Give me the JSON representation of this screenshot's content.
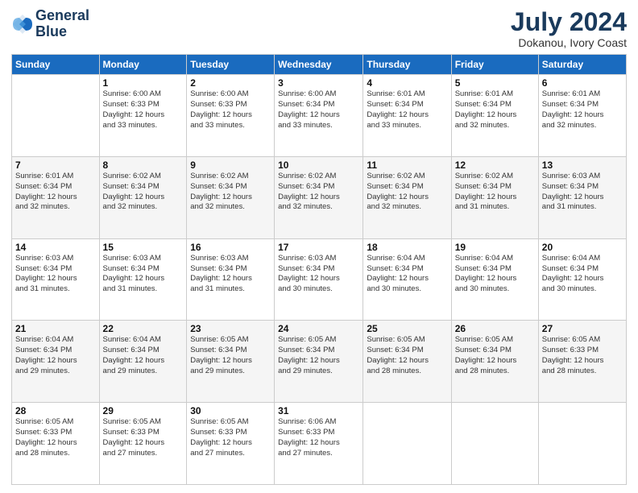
{
  "logo": {
    "line1": "General",
    "line2": "Blue"
  },
  "title": {
    "month_year": "July 2024",
    "location": "Dokanou, Ivory Coast"
  },
  "days_of_week": [
    "Sunday",
    "Monday",
    "Tuesday",
    "Wednesday",
    "Thursday",
    "Friday",
    "Saturday"
  ],
  "weeks": [
    [
      {
        "day": "",
        "info": ""
      },
      {
        "day": "1",
        "info": "Sunrise: 6:00 AM\nSunset: 6:33 PM\nDaylight: 12 hours\nand 33 minutes."
      },
      {
        "day": "2",
        "info": "Sunrise: 6:00 AM\nSunset: 6:33 PM\nDaylight: 12 hours\nand 33 minutes."
      },
      {
        "day": "3",
        "info": "Sunrise: 6:00 AM\nSunset: 6:34 PM\nDaylight: 12 hours\nand 33 minutes."
      },
      {
        "day": "4",
        "info": "Sunrise: 6:01 AM\nSunset: 6:34 PM\nDaylight: 12 hours\nand 33 minutes."
      },
      {
        "day": "5",
        "info": "Sunrise: 6:01 AM\nSunset: 6:34 PM\nDaylight: 12 hours\nand 32 minutes."
      },
      {
        "day": "6",
        "info": "Sunrise: 6:01 AM\nSunset: 6:34 PM\nDaylight: 12 hours\nand 32 minutes."
      }
    ],
    [
      {
        "day": "7",
        "info": "Sunrise: 6:01 AM\nSunset: 6:34 PM\nDaylight: 12 hours\nand 32 minutes."
      },
      {
        "day": "8",
        "info": "Sunrise: 6:02 AM\nSunset: 6:34 PM\nDaylight: 12 hours\nand 32 minutes."
      },
      {
        "day": "9",
        "info": "Sunrise: 6:02 AM\nSunset: 6:34 PM\nDaylight: 12 hours\nand 32 minutes."
      },
      {
        "day": "10",
        "info": "Sunrise: 6:02 AM\nSunset: 6:34 PM\nDaylight: 12 hours\nand 32 minutes."
      },
      {
        "day": "11",
        "info": "Sunrise: 6:02 AM\nSunset: 6:34 PM\nDaylight: 12 hours\nand 32 minutes."
      },
      {
        "day": "12",
        "info": "Sunrise: 6:02 AM\nSunset: 6:34 PM\nDaylight: 12 hours\nand 31 minutes."
      },
      {
        "day": "13",
        "info": "Sunrise: 6:03 AM\nSunset: 6:34 PM\nDaylight: 12 hours\nand 31 minutes."
      }
    ],
    [
      {
        "day": "14",
        "info": "Sunrise: 6:03 AM\nSunset: 6:34 PM\nDaylight: 12 hours\nand 31 minutes."
      },
      {
        "day": "15",
        "info": "Sunrise: 6:03 AM\nSunset: 6:34 PM\nDaylight: 12 hours\nand 31 minutes."
      },
      {
        "day": "16",
        "info": "Sunrise: 6:03 AM\nSunset: 6:34 PM\nDaylight: 12 hours\nand 31 minutes."
      },
      {
        "day": "17",
        "info": "Sunrise: 6:03 AM\nSunset: 6:34 PM\nDaylight: 12 hours\nand 30 minutes."
      },
      {
        "day": "18",
        "info": "Sunrise: 6:04 AM\nSunset: 6:34 PM\nDaylight: 12 hours\nand 30 minutes."
      },
      {
        "day": "19",
        "info": "Sunrise: 6:04 AM\nSunset: 6:34 PM\nDaylight: 12 hours\nand 30 minutes."
      },
      {
        "day": "20",
        "info": "Sunrise: 6:04 AM\nSunset: 6:34 PM\nDaylight: 12 hours\nand 30 minutes."
      }
    ],
    [
      {
        "day": "21",
        "info": "Sunrise: 6:04 AM\nSunset: 6:34 PM\nDaylight: 12 hours\nand 29 minutes."
      },
      {
        "day": "22",
        "info": "Sunrise: 6:04 AM\nSunset: 6:34 PM\nDaylight: 12 hours\nand 29 minutes."
      },
      {
        "day": "23",
        "info": "Sunrise: 6:05 AM\nSunset: 6:34 PM\nDaylight: 12 hours\nand 29 minutes."
      },
      {
        "day": "24",
        "info": "Sunrise: 6:05 AM\nSunset: 6:34 PM\nDaylight: 12 hours\nand 29 minutes."
      },
      {
        "day": "25",
        "info": "Sunrise: 6:05 AM\nSunset: 6:34 PM\nDaylight: 12 hours\nand 28 minutes."
      },
      {
        "day": "26",
        "info": "Sunrise: 6:05 AM\nSunset: 6:34 PM\nDaylight: 12 hours\nand 28 minutes."
      },
      {
        "day": "27",
        "info": "Sunrise: 6:05 AM\nSunset: 6:33 PM\nDaylight: 12 hours\nand 28 minutes."
      }
    ],
    [
      {
        "day": "28",
        "info": "Sunrise: 6:05 AM\nSunset: 6:33 PM\nDaylight: 12 hours\nand 28 minutes."
      },
      {
        "day": "29",
        "info": "Sunrise: 6:05 AM\nSunset: 6:33 PM\nDaylight: 12 hours\nand 27 minutes."
      },
      {
        "day": "30",
        "info": "Sunrise: 6:05 AM\nSunset: 6:33 PM\nDaylight: 12 hours\nand 27 minutes."
      },
      {
        "day": "31",
        "info": "Sunrise: 6:06 AM\nSunset: 6:33 PM\nDaylight: 12 hours\nand 27 minutes."
      },
      {
        "day": "",
        "info": ""
      },
      {
        "day": "",
        "info": ""
      },
      {
        "day": "",
        "info": ""
      }
    ]
  ]
}
